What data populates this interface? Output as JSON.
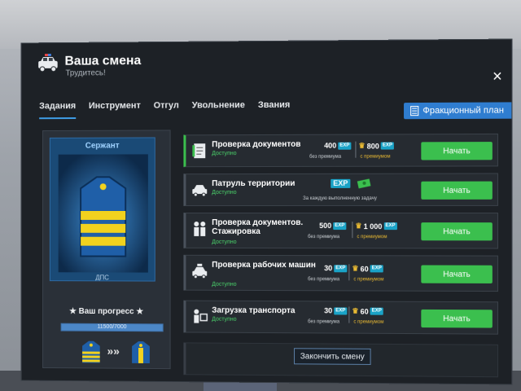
{
  "window": {
    "title": "Ваша смена",
    "subtitle": "Трудитесь!",
    "close_label": "×"
  },
  "tabs": [
    {
      "label": "Задания",
      "active": true
    },
    {
      "label": "Инструмент",
      "active": false
    },
    {
      "label": "Отгул",
      "active": false
    },
    {
      "label": "Увольнение",
      "active": false
    },
    {
      "label": "Звания",
      "active": false
    }
  ],
  "faction_plan": {
    "label": "Фракционный план",
    "icon": "document-icon"
  },
  "rank_card": {
    "rank": "Сержант",
    "footer": "ДПС",
    "progress_label": "Ваш прогресс",
    "progress_text": "11500/7000",
    "progress_fraction": 1.0,
    "star": "★",
    "arrows": "»»"
  },
  "tasks": [
    {
      "name": "Проверка документов",
      "status": "Доступно",
      "icon": "document-check-icon",
      "exp_base": "400",
      "exp_base_sub": "без премиума",
      "exp_premium": "800",
      "exp_premium_sub": "с премиумом",
      "start_label": "Начать"
    },
    {
      "name": "Патруль территории",
      "status": "Доступно",
      "icon": "police-car-icon",
      "exp_note": "За каждую выполненную задачу",
      "start_label": "Начать"
    },
    {
      "name": "Проверка документов. Стажировка",
      "status": "Доступно",
      "icon": "people-icon",
      "exp_base": "500",
      "exp_base_sub": "без премиума",
      "exp_premium": "1 000",
      "exp_premium_sub": "с премиумом",
      "start_label": "Начать"
    },
    {
      "name": "Проверка рабочих машин",
      "status": "Доступно",
      "icon": "taxi-icon",
      "exp_base": "30",
      "exp_base_sub": "без премиума",
      "exp_premium": "60",
      "exp_premium_sub": "с премиумом",
      "start_label": "Начать"
    },
    {
      "name": "Загрузка транспорта",
      "status": "Доступно",
      "icon": "loader-icon",
      "exp_base": "30",
      "exp_base_sub": "без премиума",
      "exp_premium": "60",
      "exp_premium_sub": "с премиумом",
      "start_label": "Начать"
    }
  ],
  "exp_tag": "EXP",
  "finish_shift": "Закончить смену",
  "colors": {
    "accent": "#2f7dd0",
    "start": "#3bbf4e",
    "available": "#4bd36b",
    "premium": "#e8b933",
    "exp": "#1aa3c7"
  }
}
